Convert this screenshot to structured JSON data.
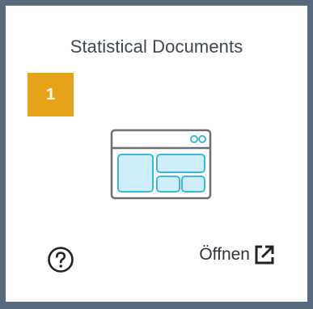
{
  "tile": {
    "title": "Statistical Documents",
    "badge": "1",
    "icon": "application-window-icon",
    "help_icon": "help-circle-icon",
    "open_label": "Öffnen",
    "open_icon": "external-link-icon"
  },
  "colors": {
    "frame": "#5a6a7d",
    "badge": "#e6a318",
    "icon_outline": "#6b6f75",
    "icon_fill": "#cfeefa",
    "icon_stroke": "#3ab7e6"
  }
}
